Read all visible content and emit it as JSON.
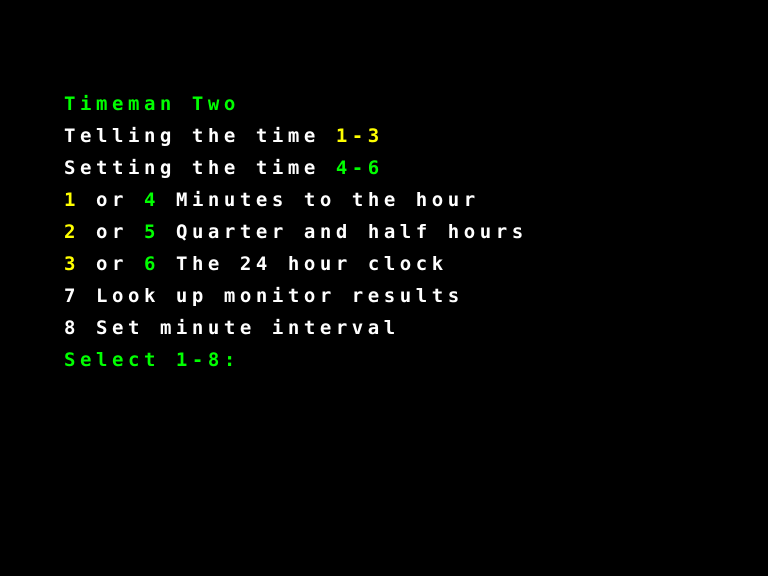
{
  "colors": {
    "background": "#000000",
    "text": "#ffffff",
    "heading": "#00ff00",
    "range_telling": "#ffff00",
    "range_setting": "#00ff00"
  },
  "title": "Timeman Two",
  "telling": {
    "label": "Telling the time ",
    "range": "1-3"
  },
  "setting": {
    "label": "Setting the time ",
    "range": "4-6"
  },
  "menu": {
    "or": " or ",
    "options": [
      {
        "key_a": "1",
        "key_b": "4",
        "label": " Minutes to the hour"
      },
      {
        "key_a": "2",
        "key_b": "5",
        "label": " Quarter and half hours"
      },
      {
        "key_a": "3",
        "key_b": "6",
        "label": " The 24 hour clock"
      }
    ],
    "monitor": {
      "key": "7",
      "label": " Look up monitor results"
    },
    "interval": {
      "key": "8",
      "label": " Set minute interval"
    }
  },
  "prompt": "Select 1-8:"
}
